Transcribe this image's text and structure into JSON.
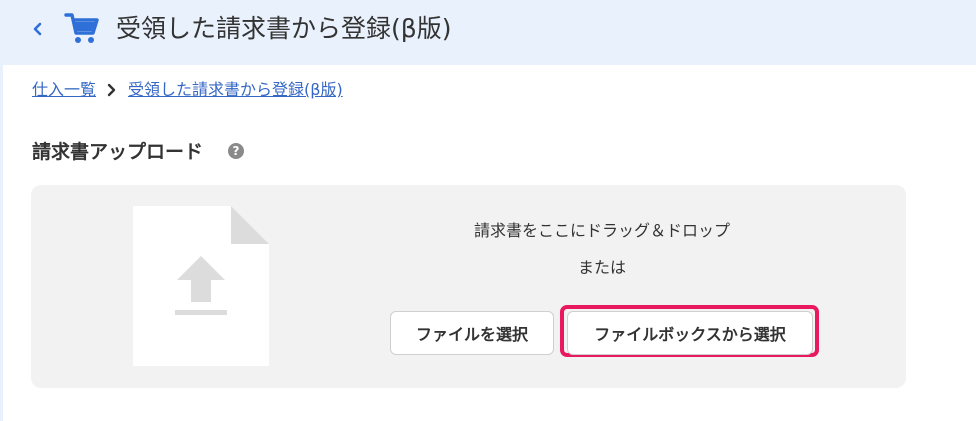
{
  "header": {
    "title": "受領した請求書から登録(β版)",
    "back_icon": "chevron-left-icon",
    "cart_icon": "shopping-cart-icon",
    "accent_color": "#2f6fd8",
    "background_color": "#e9f1fc"
  },
  "breadcrumb": {
    "items": [
      {
        "label": "仕入一覧"
      },
      {
        "label": "受領した請求書から登録(β版)"
      }
    ],
    "separator_icon": "chevron-right-icon"
  },
  "upload": {
    "section_title": "請求書アップロード",
    "help_icon": "question-circle-icon",
    "help_glyph": "?",
    "drop_text": "請求書をここにドラッグ＆ドロップ",
    "or_text": "または",
    "select_file_label": "ファイルを選択",
    "select_filebox_label": "ファイルボックスから選択",
    "highlight_color": "#e8195f",
    "file_icon": "file-upload-icon"
  }
}
